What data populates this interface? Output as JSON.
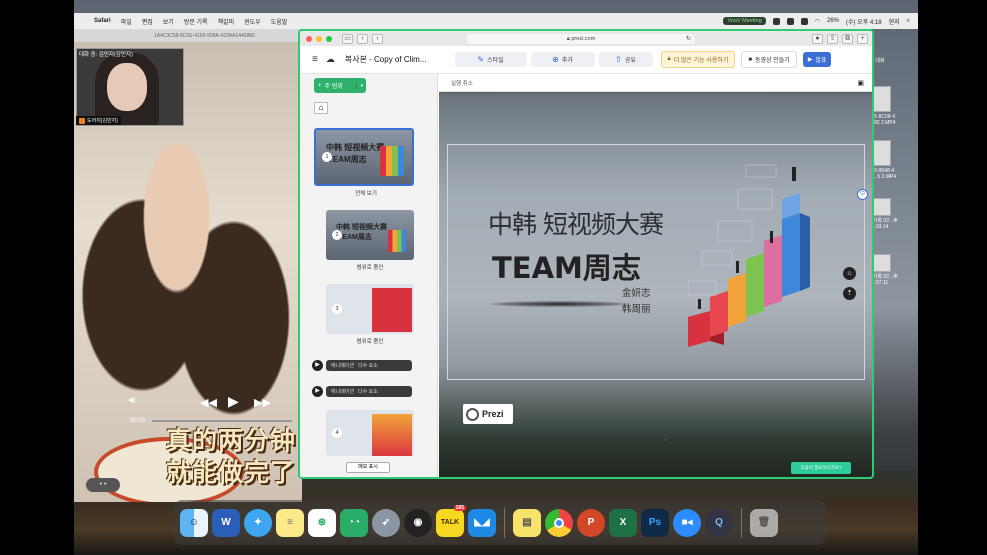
{
  "menubar": {
    "app": "Safari",
    "items": [
      "파일",
      "편집",
      "보기",
      "방문 기록",
      "책갈피",
      "윈도우",
      "도움말"
    ],
    "voov_label": "VooV Meeting",
    "battery": "26%",
    "datetime": "(수) 오후 4:18",
    "user": "현지"
  },
  "safari_back": {
    "url_text": "1A4C3C58-6C0E-4165-909A-423AA1445866"
  },
  "desktop_files": [
    {
      "label": "대화"
    },
    {
      "label": "3C55-8C08-4 99...82 2.MP4"
    },
    {
      "label": "1850-9048-4 3C1...5 2.MP4"
    },
    {
      "label": "회면 기록 02...후 4.03.14"
    },
    {
      "label": "회면 기록 02...후 4.07.11"
    }
  ],
  "video_call": {
    "pip_title": "대화 중: 김민지(김민지)",
    "pip_name": "도어지(김민지)",
    "player_time": "00:00",
    "subtitle_line1": "真的两分钟",
    "subtitle_line2": "就能做完了"
  },
  "browser": {
    "url": "prezi.com",
    "reload_icon": "↻"
  },
  "prezi_toolbar": {
    "doc_title": "복사본 - Copy of Clim...",
    "style_label": "스타일",
    "add_label": "추가",
    "share_label": "공유",
    "upgrade_label": "더 많은 기능 사용하기",
    "video_label": "동영상 만들기",
    "present_label": "발표"
  },
  "sidebar": {
    "topic_button": "주 범위",
    "thumbnails": [
      {
        "num": "1",
        "t1": "中韩 短视频大赛",
        "t2": "TEAM周志",
        "label": "전체 보기"
      },
      {
        "num": "2",
        "t1": "中韩 短视频大赛",
        "t2": "TEAM周志",
        "label": "범위로 줌인"
      },
      {
        "num": "3",
        "t1": "",
        "t2": "",
        "label": "범위로 줌인"
      },
      {
        "num": "4",
        "t1": "",
        "t2": "",
        "label": ""
      }
    ],
    "anim_bars": [
      {
        "a": "애니메이션",
        "b": "다수 요소"
      },
      {
        "a": "애니메이션",
        "b": "다수 요소"
      }
    ],
    "bottom_hint": "메모 표시"
  },
  "canvas": {
    "top_label": "실행 취소",
    "title_line1": "中韩 短视频大赛",
    "title_line2": "TEAM周志",
    "name1": "金妍志",
    "name2": "韩周丽",
    "logo_text": "Prezi",
    "help_label": "도움이 필요하신가요?"
  },
  "dock": {
    "kakao_badge": "185",
    "apps": [
      "finder",
      "word",
      "safari",
      "notes",
      "wechat-mini",
      "wechat",
      "launchpad",
      "qq",
      "kakaotalk",
      "lark",
      "stickies",
      "chrome",
      "powerpoint",
      "excel",
      "photoshop",
      "zoom",
      "quicktime",
      "trash"
    ]
  }
}
